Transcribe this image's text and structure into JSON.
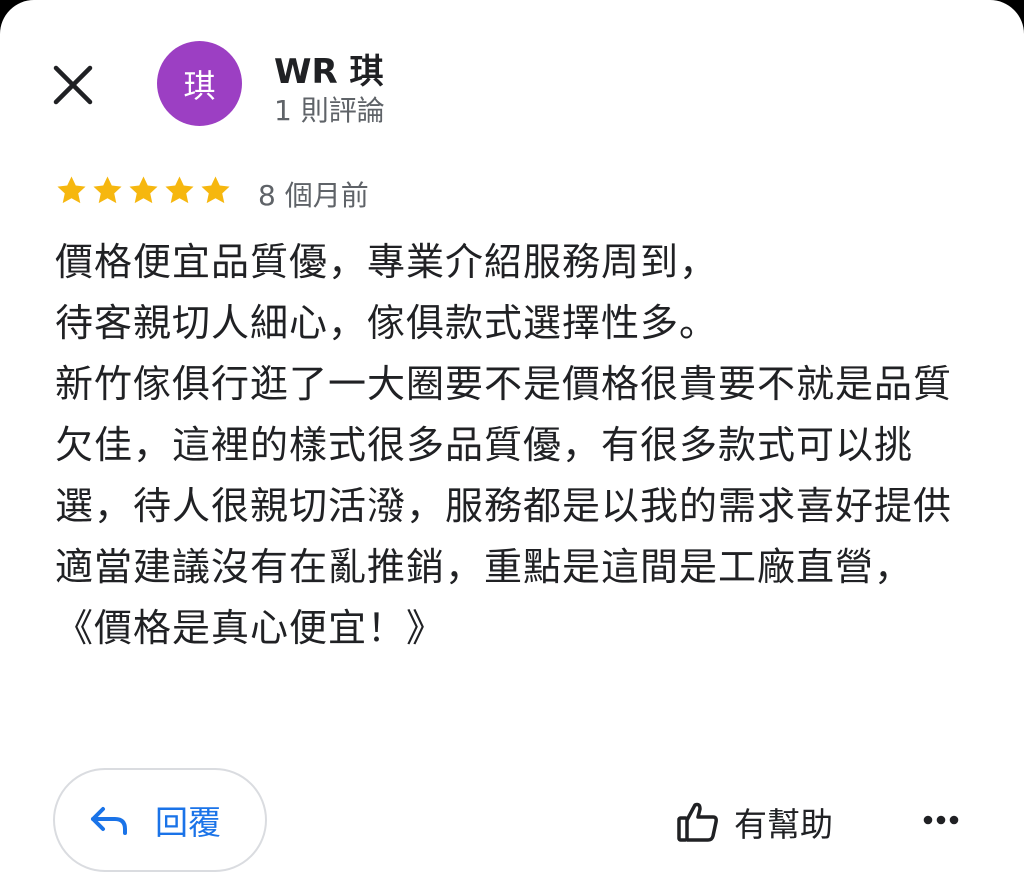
{
  "user": {
    "avatar_letter": "琪",
    "avatar_color": "#9c3fc3",
    "name": "WR 琪",
    "review_count": "1 則評論"
  },
  "review": {
    "rating": 5,
    "time_ago": "8 個月前",
    "text": "價格便宜品質優，專業介紹服務周到，\n待客親切人細心，傢俱款式選擇性多。\n新竹傢俱行逛了一大圈要不是價格很貴要不就是品質欠佳，這裡的樣式很多品質優，有很多款式可以挑選，待人很親切活潑，服務都是以我的需求喜好提供適當建議沒有在亂推銷，重點是這間是工廠直營，《價格是真心便宜！》"
  },
  "actions": {
    "reply_label": "回覆",
    "helpful_label": "有幫助"
  },
  "icons": {
    "close": "close-icon",
    "reply": "reply-arrow-icon",
    "helpful": "thumbs-up-icon",
    "more": "more-horizontal-icon",
    "star": "star-icon"
  },
  "colors": {
    "star": "#f6b70f",
    "accent": "#1a73e8"
  }
}
